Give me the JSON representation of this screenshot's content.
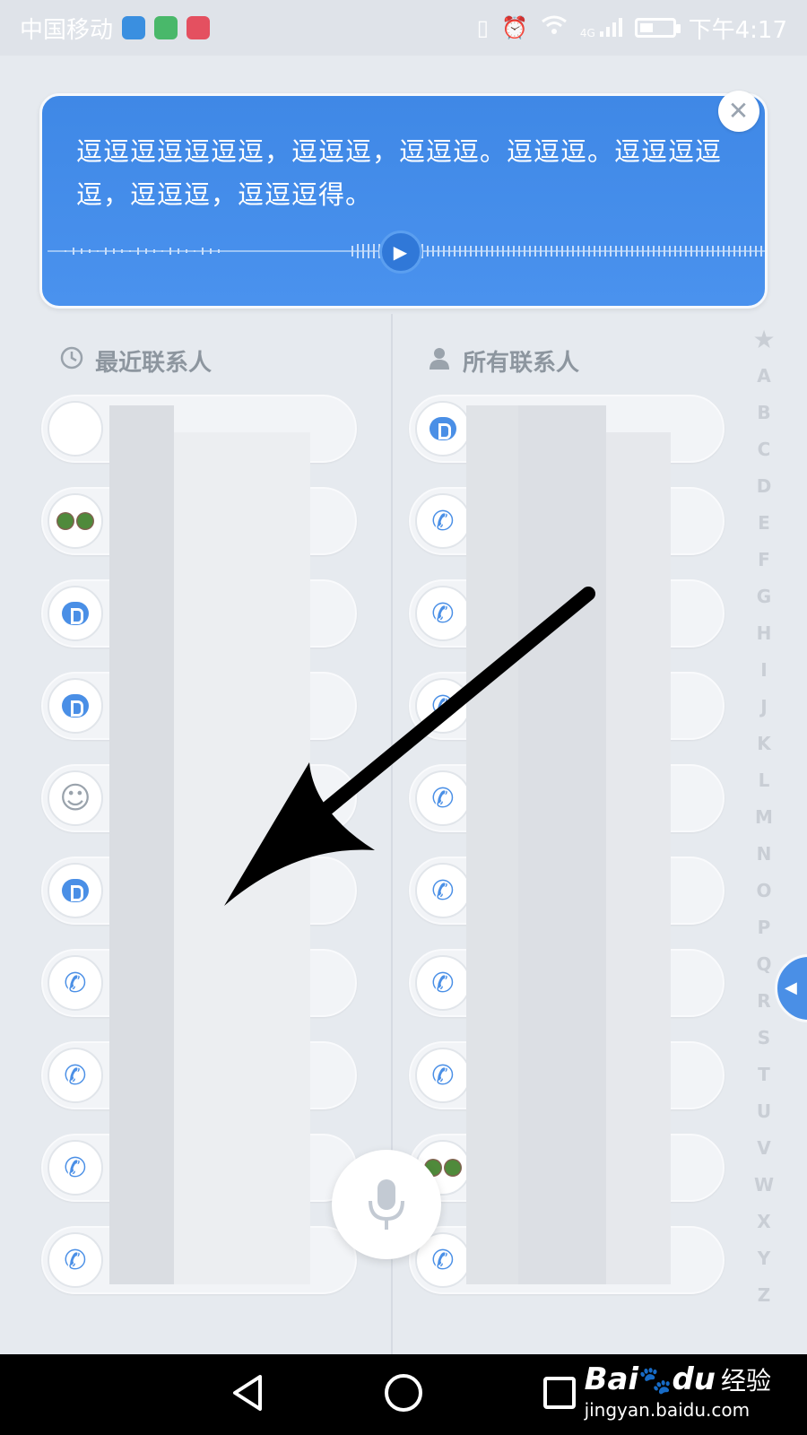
{
  "status_bar": {
    "carrier": "中国移动",
    "network": "4G",
    "time": "下午4:17"
  },
  "voice_bubble": {
    "transcript": "逗逗逗逗逗逗逗，逗逗逗，逗逗逗。逗逗逗。逗逗逗逗逗，逗逗逗，逗逗逗得。",
    "close_icon": "close-icon",
    "play_icon": "play-icon"
  },
  "recent_header": {
    "label": "最近联系人",
    "icon": "clock-icon"
  },
  "all_header": {
    "label": "所有联系人",
    "icon": "person-icon"
  },
  "recent_contacts": [
    {
      "avatar": "photo"
    },
    {
      "avatar": "photo-pair"
    },
    {
      "avatar": "message"
    },
    {
      "avatar": "message"
    },
    {
      "avatar": "sketch"
    },
    {
      "avatar": "message"
    },
    {
      "avatar": "phone"
    },
    {
      "avatar": "phone"
    },
    {
      "avatar": "phone"
    },
    {
      "avatar": "phone"
    }
  ],
  "all_contacts": [
    {
      "avatar": "message"
    },
    {
      "avatar": "phone"
    },
    {
      "avatar": "phone"
    },
    {
      "avatar": "phone"
    },
    {
      "avatar": "phone"
    },
    {
      "avatar": "phone"
    },
    {
      "avatar": "phone"
    },
    {
      "avatar": "phone"
    },
    {
      "avatar": "photo-pair"
    },
    {
      "avatar": "phone"
    }
  ],
  "alphabet_index": [
    "★",
    "A",
    "B",
    "C",
    "D",
    "E",
    "F",
    "G",
    "H",
    "I",
    "J",
    "K",
    "L",
    "M",
    "N",
    "O",
    "P",
    "Q",
    "R",
    "S",
    "T",
    "U",
    "V",
    "W",
    "X",
    "Y",
    "Z"
  ],
  "mic_button": {
    "icon": "microphone-icon"
  },
  "nav_bar": {
    "back_icon": "back-icon",
    "home_icon": "home-icon",
    "recents_icon": "recents-icon"
  },
  "watermark": {
    "logo": "Bai",
    "logo_suffix": "du",
    "cn": "经验",
    "url": "jingyan.baidu.com"
  },
  "colors": {
    "accent": "#4a8fe6",
    "bubble": "#3f88e6",
    "background": "#e6eaef"
  }
}
